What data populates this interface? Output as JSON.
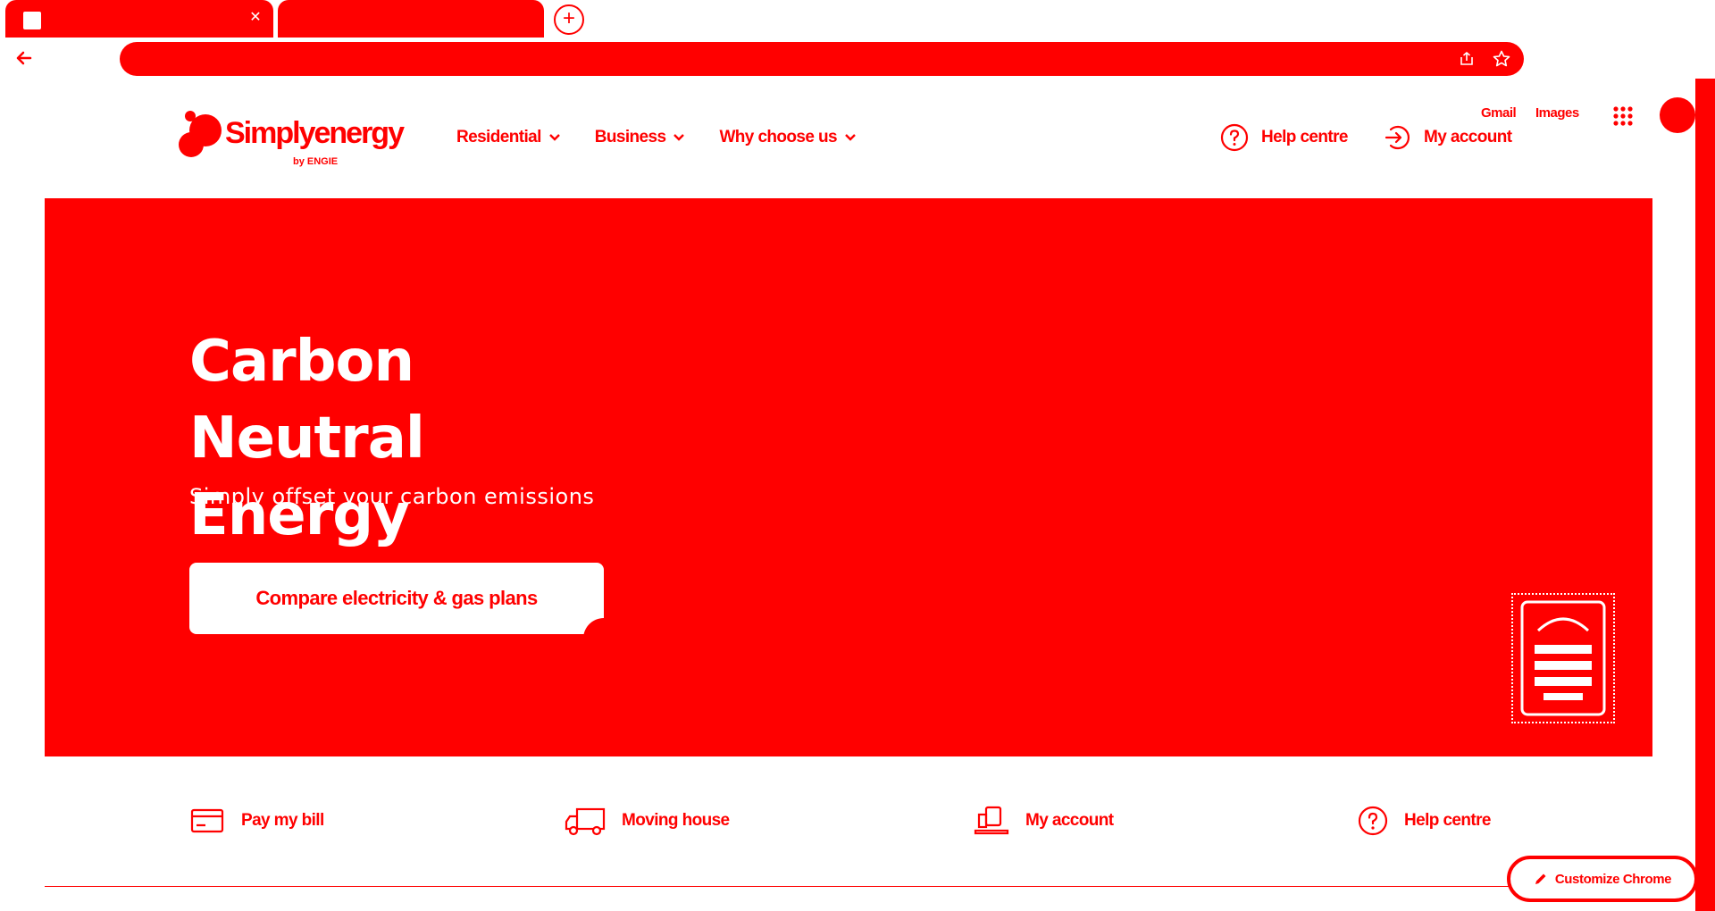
{
  "browser": {
    "tabs": [
      {
        "title": ""
      },
      {
        "title": ""
      }
    ],
    "omnibox": {
      "url": ""
    }
  },
  "google_bar": {
    "gmail": "Gmail",
    "images": "Images"
  },
  "site": {
    "logo_text": "Simplyenergy",
    "logo_byline": "by ENGIE",
    "nav": [
      {
        "label": "Residential"
      },
      {
        "label": "Business"
      },
      {
        "label": "Why choose us"
      }
    ],
    "help_label": "Help centre",
    "account_label": "My account"
  },
  "hero": {
    "title_line1": "Carbon Neutral",
    "title_line2": "Energy",
    "subtitle": "Simply offset your carbon emissions",
    "cta_label": "Compare electricity & gas plans"
  },
  "quick_links": [
    {
      "label": "Pay my bill",
      "icon": "bill-icon"
    },
    {
      "label": "Moving house",
      "icon": "truck-icon"
    },
    {
      "label": "My account",
      "icon": "laptop-icon"
    },
    {
      "label": "Help centre",
      "icon": "question-icon"
    }
  ],
  "customize_label": "Customize Chrome",
  "colors": {
    "accent": "#ff0000",
    "background": "#ffffff"
  }
}
